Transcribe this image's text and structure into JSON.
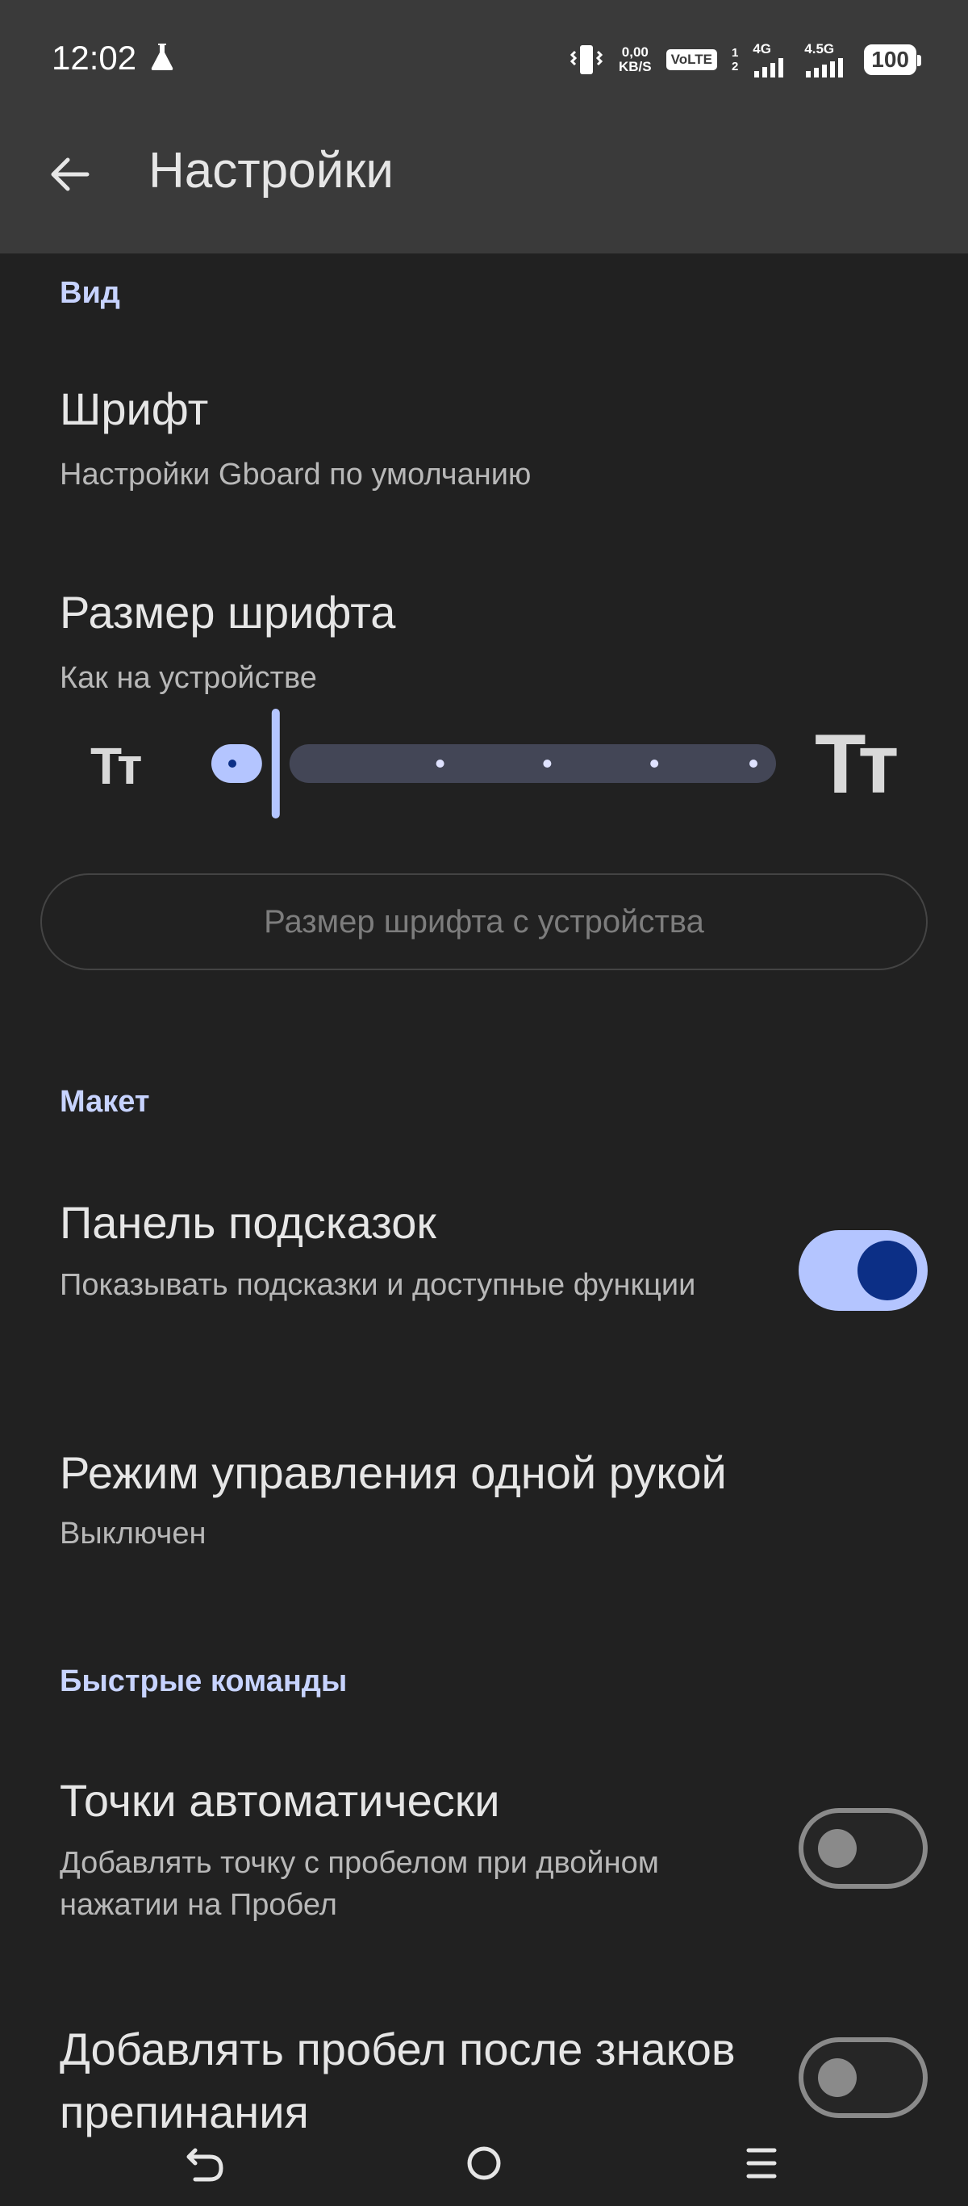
{
  "status_bar": {
    "time": "12:02",
    "speed_value": "0,00",
    "speed_unit": "KB/S",
    "volte": "VoLTE",
    "sim_slots": "1\n2",
    "network1": "4G",
    "network2": "4.5G",
    "battery": "100"
  },
  "app_bar": {
    "title": "Настройки",
    "back_icon": "arrow-back-icon"
  },
  "sections": {
    "view": {
      "header": "Вид",
      "font": {
        "title": "Шрифт",
        "subtitle": "Настройки Gboard по умолчанию"
      },
      "font_size": {
        "title": "Размер шрифта",
        "subtitle": "Как на устройстве",
        "small_label": "Тт",
        "large_label": "Тт",
        "slider_steps": 6,
        "slider_value_step": 1,
        "device_button": "Размер шрифта с устройства"
      }
    },
    "layout": {
      "header": "Макет",
      "suggestion_strip": {
        "title": "Панель подсказок",
        "subtitle": "Показывать подсказки и доступные функции",
        "enabled": true
      },
      "one_handed": {
        "title": "Режим управления одной рукой",
        "subtitle": "Выключен"
      }
    },
    "shortcuts": {
      "header": "Быстрые команды",
      "auto_period": {
        "title": "Точки автоматически",
        "subtitle": "Добавлять точку с пробелом при двойном нажатии на Пробел",
        "enabled": false
      },
      "space_after_punct": {
        "title": "Добавлять пробел после знаков препинания",
        "enabled": false
      }
    }
  },
  "colors": {
    "background": "#212121",
    "app_bar": "#3a3a3a",
    "accent": "#b4c5ff",
    "accent_dark": "#0c2f86"
  },
  "nav_bar": {
    "back": "nav-back-icon",
    "home": "nav-home-icon",
    "menu": "nav-menu-icon"
  }
}
